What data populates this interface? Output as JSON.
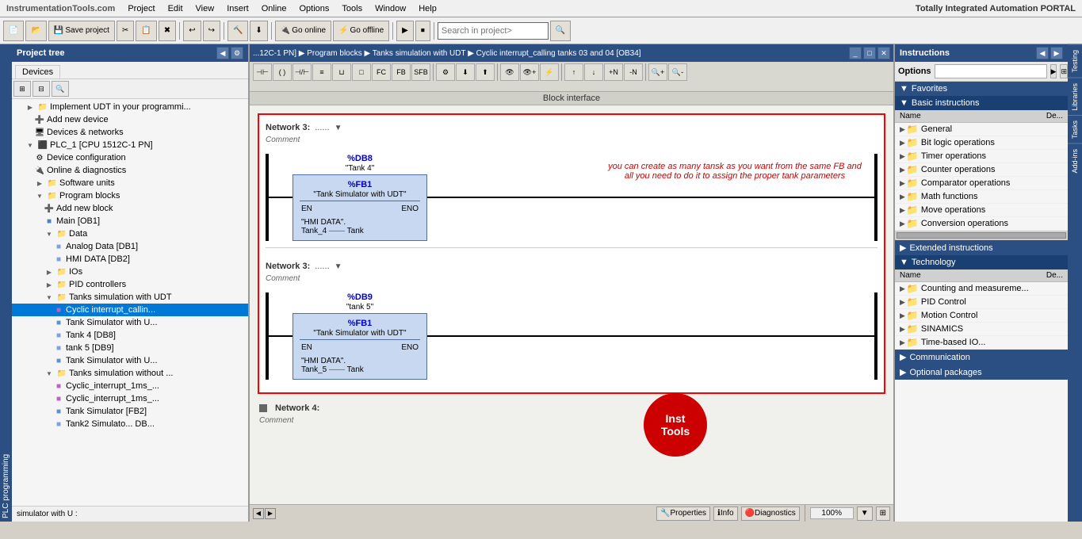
{
  "app": {
    "title": "InstrumentationTools.com",
    "branding": "Totally Integrated Automation PORTAL"
  },
  "menubar": {
    "items": [
      "Project",
      "Edit",
      "View",
      "Insert",
      "Online",
      "Options",
      "Tools",
      "Window",
      "Help"
    ]
  },
  "toolbar": {
    "save_label": "Save project",
    "go_online": "Go online",
    "go_offline": "Go offline",
    "search_placeholder": "Search in project>"
  },
  "titlebar": {
    "breadcrumb": "...12C-1 PN]  ▶  Program blocks  ▶  Tanks simulation with UDT  ▶  Cyclic interrupt_calling tanks 03 and 04 [OB34]",
    "section": "Block interface"
  },
  "left_panel": {
    "title": "Project tree",
    "tab": "Devices",
    "items": [
      {
        "id": "implement",
        "label": "Implement UDT in your programmi...",
        "indent": 1,
        "type": "text",
        "icon": "folder"
      },
      {
        "id": "add-device",
        "label": "Add new device",
        "indent": 2,
        "type": "add",
        "icon": "add"
      },
      {
        "id": "devices-networks",
        "label": "Devices & networks",
        "indent": 2,
        "type": "item",
        "icon": "devices"
      },
      {
        "id": "plc1",
        "label": "PLC_1 [CPU 1512C-1 PN]",
        "indent": 1,
        "type": "cpu",
        "icon": "cpu",
        "expanded": true
      },
      {
        "id": "device-config",
        "label": "Device configuration",
        "indent": 2,
        "type": "item",
        "icon": "config"
      },
      {
        "id": "online-diag",
        "label": "Online & diagnostics",
        "indent": 2,
        "type": "item",
        "icon": "online"
      },
      {
        "id": "software-units",
        "label": "Software units",
        "indent": 2,
        "type": "folder",
        "icon": "folder"
      },
      {
        "id": "program-blocks",
        "label": "Program blocks",
        "indent": 2,
        "type": "folder",
        "icon": "folder",
        "expanded": true
      },
      {
        "id": "add-block",
        "label": "Add new block",
        "indent": 3,
        "type": "add",
        "icon": "add"
      },
      {
        "id": "main-ob1",
        "label": "Main [OB1]",
        "indent": 3,
        "type": "block",
        "icon": "block"
      },
      {
        "id": "data",
        "label": "Data",
        "indent": 3,
        "type": "folder",
        "icon": "folder",
        "expanded": true
      },
      {
        "id": "analog-data",
        "label": "Analog Data [DB1]",
        "indent": 4,
        "type": "db",
        "icon": "db"
      },
      {
        "id": "hmi-data",
        "label": "HMI DATA [DB2]",
        "indent": 4,
        "type": "db",
        "icon": "db"
      },
      {
        "id": "ios",
        "label": "IOs",
        "indent": 3,
        "type": "folder",
        "icon": "folder"
      },
      {
        "id": "pid",
        "label": "PID controllers",
        "indent": 3,
        "type": "folder",
        "icon": "folder"
      },
      {
        "id": "tanks-udt",
        "label": "Tanks simulation with UDT",
        "indent": 3,
        "type": "folder",
        "icon": "folder",
        "expanded": true
      },
      {
        "id": "cyclic-calling",
        "label": "Cyclic interrupt_callin...",
        "indent": 4,
        "type": "block",
        "icon": "ob",
        "selected": true
      },
      {
        "id": "tank-sim-u",
        "label": "Tank Simulator with U...",
        "indent": 4,
        "type": "fb",
        "icon": "fb"
      },
      {
        "id": "tank4-db8",
        "label": "Tank 4 [DB8]",
        "indent": 4,
        "type": "db",
        "icon": "db"
      },
      {
        "id": "tank5-db9",
        "label": "tank 5 [DB9]",
        "indent": 4,
        "type": "db",
        "icon": "db"
      },
      {
        "id": "tank-sim-u2",
        "label": "Tank Simulator with U...",
        "indent": 4,
        "type": "fb",
        "icon": "fb"
      },
      {
        "id": "tanks-without",
        "label": "Tanks simulation without ...",
        "indent": 3,
        "type": "folder",
        "icon": "folder",
        "expanded": true
      },
      {
        "id": "cyclic-1ms-1",
        "label": "Cyclic_interrupt_1ms_...",
        "indent": 4,
        "type": "ob",
        "icon": "ob"
      },
      {
        "id": "cyclic-1ms-2",
        "label": "Cyclic_interrupt_1ms_...",
        "indent": 4,
        "type": "ob",
        "icon": "ob"
      },
      {
        "id": "tank-sim-fb2",
        "label": "Tank Simulator [FB2]",
        "indent": 4,
        "type": "fb",
        "icon": "fb"
      },
      {
        "id": "tank2-sim",
        "label": "Tank2 Simulato... DB...",
        "indent": 4,
        "type": "db",
        "icon": "db"
      }
    ],
    "simulator_label": "simulator with U :"
  },
  "ladder": {
    "networks": [
      {
        "id": "network3",
        "number": "Network 3:",
        "dots": "......",
        "comment": "Comment",
        "db_name": "%DB8",
        "db_label": "\"Tank 4\"",
        "fb_name": "%FB1",
        "fb_label": "\"Tank Simulator with UDT\"",
        "input_label1": "\"HMI DATA\".",
        "input_label2": "Tank_4",
        "input_pin": "Tank",
        "en_label": "EN",
        "eno_label": "ENO"
      },
      {
        "id": "network_partial",
        "annotation": "you can create as many tansk as you want from the same FB and all you need to do it to assign the proper tank parameters"
      },
      {
        "id": "network4_start",
        "number": "Network 3:",
        "dots": "......",
        "comment": "Comment",
        "db_name": "%DB9",
        "db_label": "\"tank 5\"",
        "fb_name": "%FB1",
        "fb_label": "\"Tank Simulator with UDT\"",
        "input_label1": "\"HMI DATA\".",
        "input_label2": "Tank_5",
        "input_pin": "Tank",
        "en_label": "EN",
        "eno_label": "ENO"
      }
    ],
    "network4_label": "Network 4:"
  },
  "status_bar": {
    "zoom": "100%"
  },
  "bottom_bar": {
    "tabs": [
      "Properties",
      "Info",
      "Diagnostics"
    ]
  },
  "right_panel": {
    "title": "Instructions",
    "options_label": "Options",
    "sections": [
      {
        "id": "favorites",
        "label": "Favorites",
        "expanded": true,
        "icon": "chevron"
      },
      {
        "id": "basic-instructions",
        "label": "Basic instructions",
        "expanded": true,
        "icon": "chevron",
        "subsections": [
          {
            "id": "general",
            "label": "General",
            "indent": 1
          },
          {
            "id": "bit-logic",
            "label": "Bit logic operations",
            "indent": 1
          },
          {
            "id": "timer",
            "label": "Timer operations",
            "indent": 1
          },
          {
            "id": "counter",
            "label": "Counter operations",
            "indent": 1
          },
          {
            "id": "comparator",
            "label": "Comparator operations",
            "indent": 1
          },
          {
            "id": "math",
            "label": "Math functions",
            "indent": 1
          },
          {
            "id": "move",
            "label": "Move operations",
            "indent": 1
          },
          {
            "id": "conversion",
            "label": "Conversion operations",
            "indent": 1
          }
        ]
      },
      {
        "id": "extended-instructions",
        "label": "Extended instructions",
        "expanded": false,
        "icon": "chevron"
      },
      {
        "id": "technology",
        "label": "Technology",
        "expanded": true,
        "icon": "chevron",
        "subsections": [
          {
            "id": "counting",
            "label": "Counting and measureme...",
            "indent": 1
          },
          {
            "id": "pid-ctrl",
            "label": "PID Control",
            "indent": 1
          },
          {
            "id": "motion",
            "label": "Motion Control",
            "indent": 1
          },
          {
            "id": "sinamics",
            "label": "SINAMICS",
            "indent": 1
          },
          {
            "id": "time-based",
            "label": "Time-based IO...",
            "indent": 1
          }
        ]
      }
    ],
    "bottom_sections": [
      {
        "id": "communication",
        "label": "Communication"
      },
      {
        "id": "optional",
        "label": "Optional packages"
      }
    ],
    "side_tabs": [
      "Testing",
      "Libraries",
      "Tasks",
      "Add-ins"
    ],
    "header_cols": {
      "name": "Name",
      "de": "De..."
    }
  },
  "inst_tools": {
    "line1": "Inst",
    "line2": "Tools"
  }
}
